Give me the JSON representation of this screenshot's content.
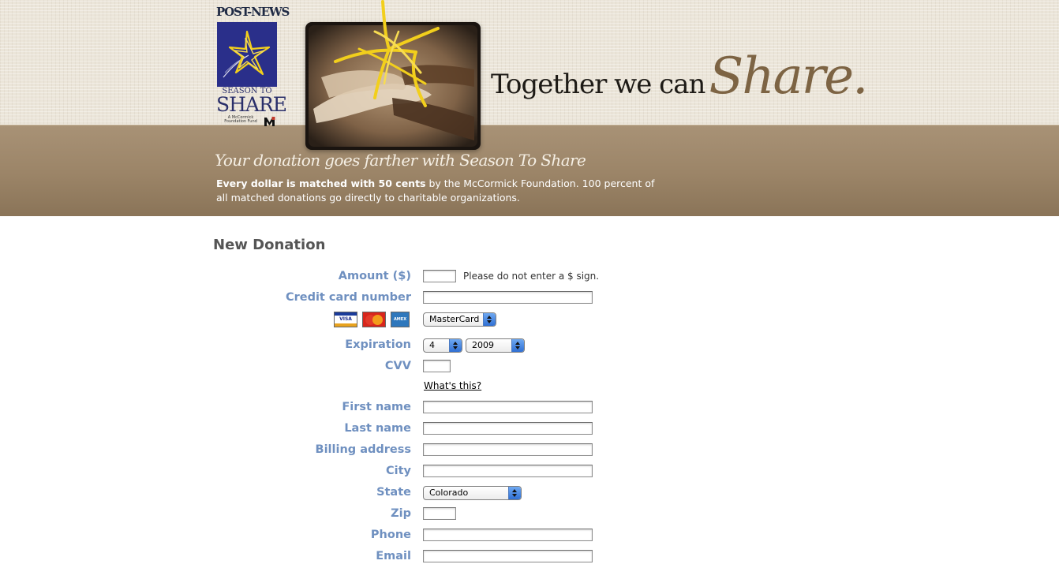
{
  "header": {
    "logo": {
      "masthead": "POST-NEWS",
      "season_line": "SEASON TO",
      "share_line": "SHARE",
      "fund_line": "A McCormick Foundation Fund",
      "fund_mark": "M"
    },
    "headline": {
      "lead": "Together we can",
      "emphasis": "Share."
    },
    "tagline": "Your donation goes farther with Season To Share",
    "match": {
      "bold": "Every dollar is matched with 50 cents",
      "rest": " by the McCormick Foundation. 100 percent of all matched donations go directly to charitable organizations."
    },
    "colors": {
      "band": "#9b8467",
      "texture": "#ebe5d9",
      "star": "#f2cf1c",
      "share_word": "#7d6444"
    }
  },
  "form": {
    "title": "New Donation",
    "amount": {
      "label": "Amount ($)",
      "value": "",
      "hint": "Please do not enter a $ sign."
    },
    "credit_card": {
      "label": "Credit card number",
      "value": ""
    },
    "card_icons": [
      "VISA",
      "MasterCard",
      "AMEX"
    ],
    "card_type": {
      "selected": "MasterCard"
    },
    "expiration": {
      "label": "Expiration",
      "month": "4",
      "year": "2009"
    },
    "cvv": {
      "label": "CVV",
      "value": "",
      "help_link": "What's this?"
    },
    "first_name": {
      "label": "First name",
      "value": ""
    },
    "last_name": {
      "label": "Last name",
      "value": ""
    },
    "billing_address": {
      "label": "Billing address",
      "value": ""
    },
    "city": {
      "label": "City",
      "value": ""
    },
    "state": {
      "label": "State",
      "selected": "Colorado"
    },
    "zip": {
      "label": "Zip",
      "value": ""
    },
    "phone": {
      "label": "Phone",
      "value": ""
    },
    "email": {
      "label": "Email",
      "value": ""
    },
    "colors": {
      "label": "#6f90c0",
      "title": "#555555",
      "select_arrow": "#2f6fd3"
    }
  }
}
